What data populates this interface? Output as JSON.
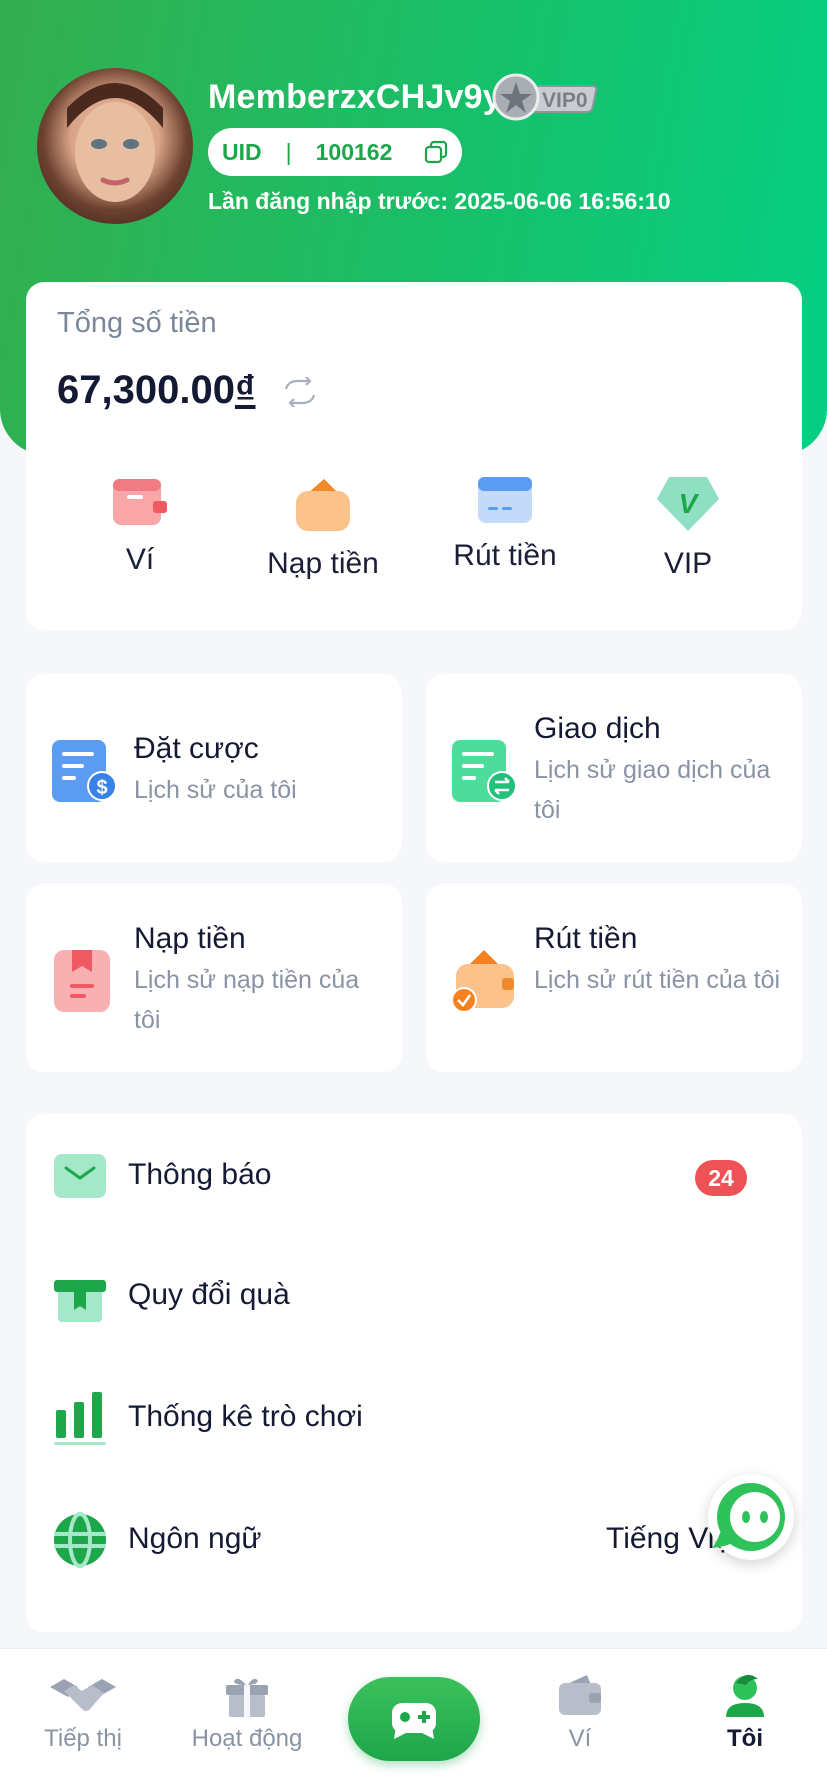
{
  "profile": {
    "username": "MemberzxCHJv9y",
    "vip_badge": "VIP0",
    "uid_label": "UID",
    "uid_separator": "|",
    "uid_value": "100162",
    "last_login": "Lần đăng nhập trước: 2025-06-06 16:56:10"
  },
  "balance": {
    "label": "Tổng số tiền",
    "amount": "67,300.00",
    "currency": "₫"
  },
  "quick_actions": [
    {
      "label": "Ví",
      "icon": "wallet-icon"
    },
    {
      "label": "Nạp tiền",
      "icon": "deposit-icon"
    },
    {
      "label": "Rút tiền",
      "icon": "card-icon"
    },
    {
      "label": "VIP",
      "icon": "vip-diamond-icon"
    }
  ],
  "history_tiles": [
    {
      "title": "Đặt cược",
      "subtitle": "Lịch sử của tôi",
      "icon": "bet-history-icon"
    },
    {
      "title": "Giao dịch",
      "subtitle": "Lịch sử giao dịch của tôi",
      "icon": "transaction-icon"
    },
    {
      "title": "Nạp tiền",
      "subtitle": "Lịch sử nạp tiền của tôi",
      "icon": "deposit-history-icon"
    },
    {
      "title": "Rút tiền",
      "subtitle": "Lịch sử rút tiền của tôi",
      "icon": "withdraw-history-icon"
    }
  ],
  "menu": [
    {
      "label": "Thông báo",
      "badge": "24",
      "icon": "mail-icon"
    },
    {
      "label": "Quy đổi quà",
      "icon": "gift-icon"
    },
    {
      "label": "Thống kê trò chơi",
      "icon": "stats-icon"
    },
    {
      "label": "Ngôn ngữ",
      "value": "Tiếng Việt",
      "icon": "globe-icon"
    }
  ],
  "bottom_nav": [
    {
      "label": "Tiếp thị",
      "icon": "handshake-icon"
    },
    {
      "label": "Hoạt động",
      "icon": "gift-icon"
    },
    {
      "label": "",
      "icon": "gamepad-icon"
    },
    {
      "label": "Ví",
      "icon": "wallet-icon"
    },
    {
      "label": "Tôi",
      "icon": "user-icon",
      "active": true
    }
  ],
  "colors": {
    "brand_green": "#1ea64a",
    "header_gradient_start": "#35ae4f",
    "header_gradient_end": "#05cf84",
    "badge_red": "#ef5256"
  }
}
